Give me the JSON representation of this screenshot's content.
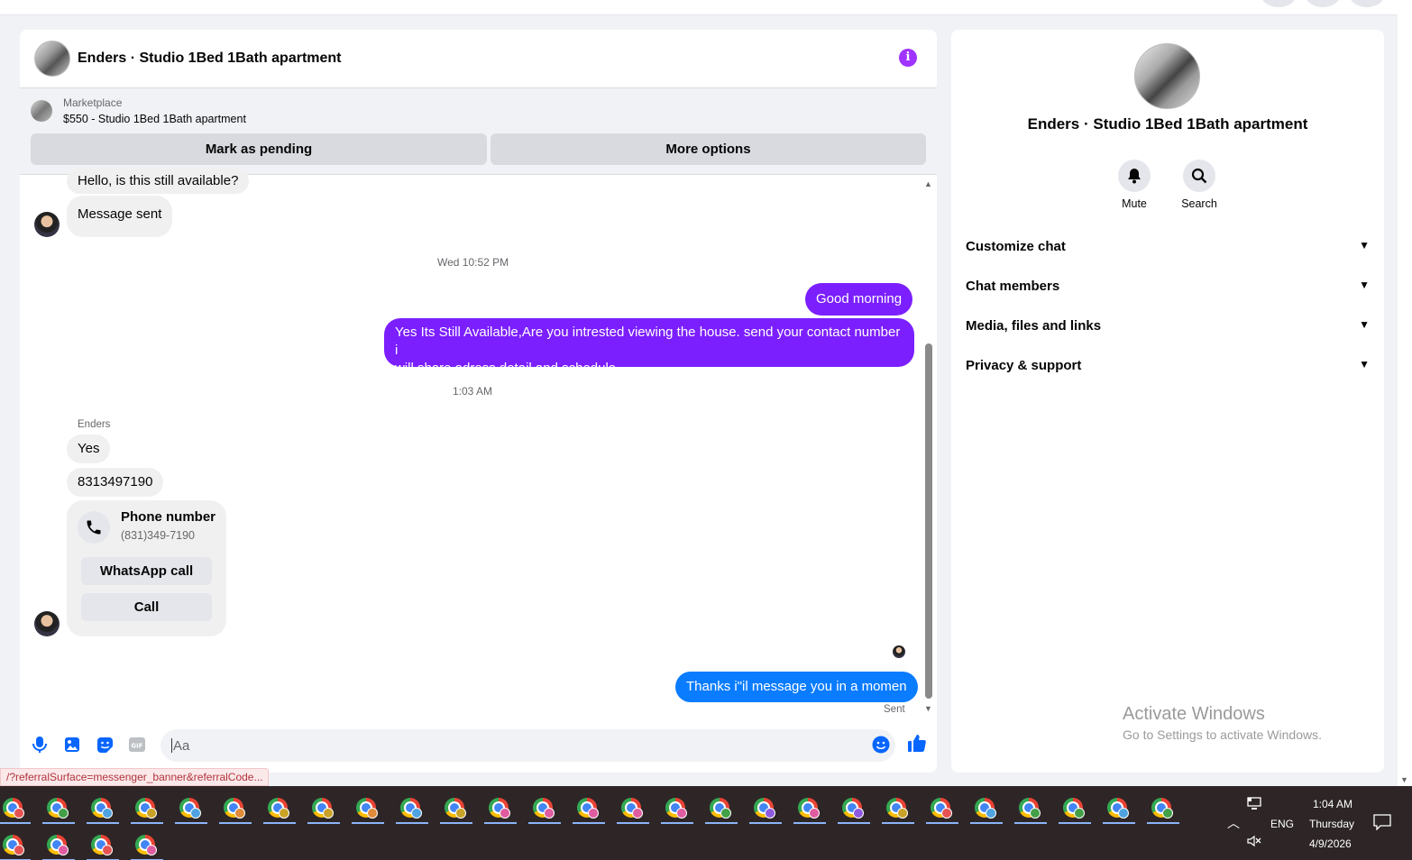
{
  "chat": {
    "title": "Enders · Studio 1Bed 1Bath apartment",
    "info_icon": "info-icon",
    "marketplace": {
      "label": "Marketplace",
      "listing": "$550 - Studio 1Bed 1Bath apartment",
      "mark_pending": "Mark as pending",
      "more_options": "More options"
    },
    "messages": {
      "m1": "Hello, is this still available?",
      "m2": "Message sent",
      "ts1": "Wed 10:52 PM",
      "o1": "Good morning",
      "o2_line1": "Yes Its Still Available,Are you intrested viewing the house. send your contact number i",
      "o2_line2": "will share adress,detail and schedule.",
      "ts2": "1:03 AM",
      "sender": "Enders",
      "r1": "Yes",
      "r2": "8313497190",
      "card_title": "Phone number",
      "card_number": "(831)349-7190",
      "whatsapp": "WhatsApp call",
      "call": "Call",
      "o3": "Thanks i\"il message you in a momen",
      "sent": "Sent"
    },
    "composer": {
      "placeholder": "Aa"
    }
  },
  "side": {
    "title": "Enders · Studio 1Bed 1Bath apartment",
    "mute": "Mute",
    "search": "Search",
    "sections": [
      "Customize chat",
      "Chat members",
      "Media, files and links",
      "Privacy & support"
    ],
    "watermark_title": "Activate Windows",
    "watermark_sub": "Go to Settings to activate Windows."
  },
  "status_url": "/?referralSurface=messenger_banner&referralCode...",
  "taskbar": {
    "time": "1:04 AM",
    "day": "Thursday",
    "date": "4/9/2026",
    "lang": "ENG",
    "profile_colors": [
      "#e55353",
      "#43a047",
      "#4fa3e0",
      "#c9a227",
      "#4fa3e0",
      "#e08a3a",
      "#c9a227",
      "#c9a227",
      "#e08a3a",
      "#4fa3e0",
      "#c9a227",
      "#e05ca0",
      "#e05ca0",
      "#e05ca0",
      "#e05ca0",
      "#e05ca0",
      "#43a047",
      "#8e5be0",
      "#e05ca0",
      "#8e5be0",
      "#c9a227",
      "#e55353",
      "#4fa3e0",
      "#43a047",
      "#43a047",
      "#4fa3e0",
      "#43a047",
      "#e55353",
      "#e05ca0",
      "#e55353",
      "#e05ca0"
    ]
  }
}
